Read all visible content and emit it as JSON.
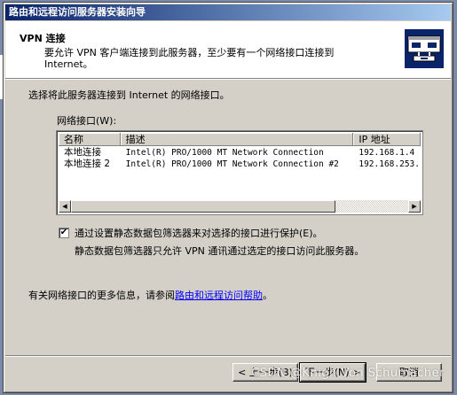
{
  "window": {
    "title": "路由和远程访问服务器安装向导"
  },
  "header": {
    "title": "VPN 连接",
    "description": "要允许 VPN 客户端连接到此服务器，至少要有一个网络接口连接到 Internet。"
  },
  "main": {
    "prompt": "选择将此服务器连接到 Internet 的网络接口。",
    "list_label": "网络接口(W):",
    "columns": [
      "名称",
      "描述",
      "IP 地址"
    ],
    "rows": [
      {
        "name": "本地连接",
        "description": "Intel(R) PRO/1000 MT Network Connection",
        "ip": "192.168.1.4"
      },
      {
        "name": "本地连接 2",
        "description": "Intel(R) PRO/1000 MT Network Connection #2",
        "ip": "192.168.253."
      }
    ],
    "checkbox": {
      "label": "通过设置静态数据包筛选器来对选择的接口进行保护(E)。",
      "checked": "✔"
    },
    "checkbox_description": "静态数据包筛选器只允许 VPN 通讯通过选定的接口访问此服务器。",
    "more_info_prefix": "有关网络接口的更多信息，请参阅",
    "more_info_link": "路由和远程访问帮助",
    "more_info_suffix": "。"
  },
  "footer": {
    "back": "< 上一步(B)",
    "next": "下一步(N) >",
    "cancel": "取消"
  },
  "watermark": "CSDN @Knigh Von Schumacher",
  "colors": {
    "title_start": "#0a246a",
    "title_end": "#a6caf0",
    "dialog_bg": "#d4d0c8",
    "link": "#0000ff"
  }
}
